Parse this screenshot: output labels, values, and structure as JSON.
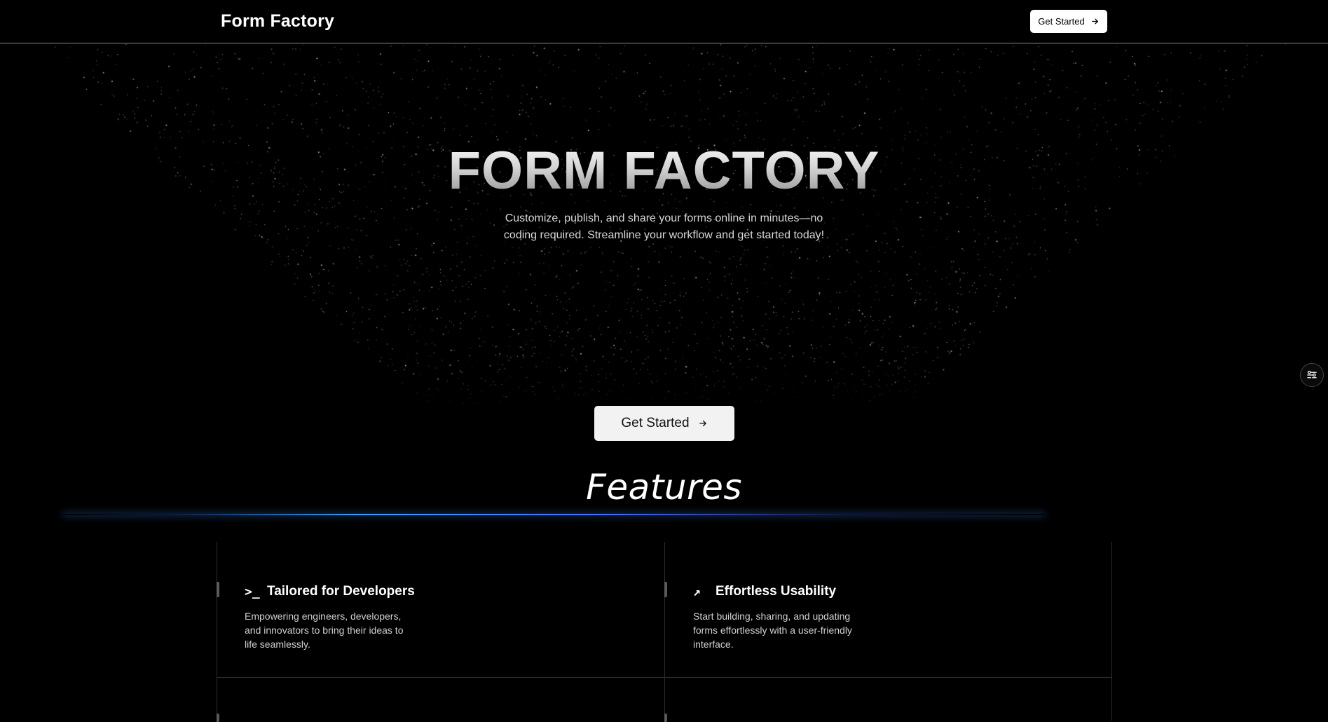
{
  "header": {
    "brand": "Form Factory",
    "cta_label": "Get Started",
    "cta_icon": "arrow-right-icon"
  },
  "hero": {
    "title": "FORM FACTORY",
    "subtitle": "Customize, publish, and share your forms online in minutes—no coding required. Streamline your workflow and get started today!",
    "cta_label": "Get Started",
    "cta_icon": "arrow-right-icon"
  },
  "floating_button": {
    "icon": "settings-sliders-icon"
  },
  "features": {
    "title": "Features",
    "items": [
      {
        "icon": "terminal-icon",
        "icon_glyph": ">_",
        "title": "Tailored for Developers",
        "description": "Empowering engineers, developers, and innovators to bring their ideas to life seamlessly."
      },
      {
        "icon": "arrow-up-right-icon",
        "icon_glyph": "↗",
        "title": "Effortless Usability",
        "description": "Start building, sharing, and updating forms effortlessly with a user-friendly interface."
      }
    ]
  },
  "colors": {
    "background": "#000000",
    "text": "#ffffff",
    "muted_text": "#d0d0d0",
    "button_bg": "#ffffff",
    "glow_blue": "#3aa0ff"
  }
}
